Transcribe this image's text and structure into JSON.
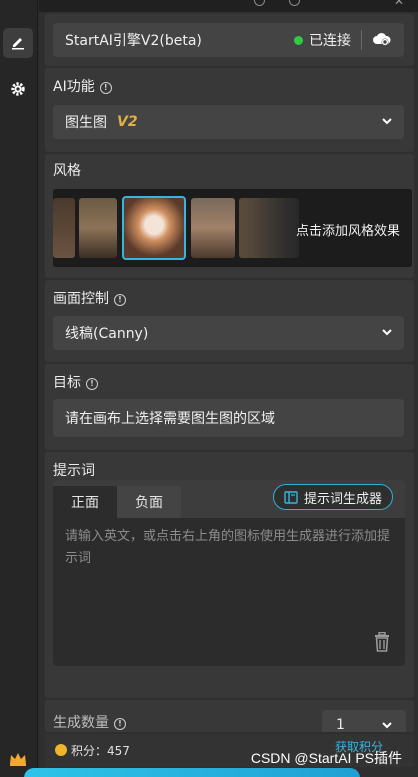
{
  "engine": {
    "title": "StartAI引擎V2(beta)",
    "status": "已连接"
  },
  "ai_function": {
    "label": "AI功能",
    "value": "图生图",
    "badge": "V2"
  },
  "style": {
    "label": "风格",
    "add_text": "点击添加风格效果"
  },
  "canvas_control": {
    "label": "画面控制",
    "value": "线稿(Canny)"
  },
  "target": {
    "label": "目标",
    "value": "请在画布上选择需要图生图的区域"
  },
  "prompt": {
    "label": "提示词",
    "tabs": [
      "正面",
      "负面"
    ],
    "generator_label": "提示词生成器",
    "placeholder": "请输入英文，或点击右上角的图标使用生成器进行添加提示词"
  },
  "gen_count": {
    "label": "生成数量",
    "value": "1"
  },
  "footer": {
    "points_label": "积分：457",
    "get_more": "获取积分"
  },
  "watermark": "CSDN @StartAI PS插件",
  "colors": {
    "accent": "#36b5e0",
    "status_green": "#2ecc40",
    "badge_gold": "#e0b040",
    "bg_panel": "#383838"
  },
  "icons": [
    "edit-icon",
    "gear-icon",
    "cloud-settings-icon",
    "chevron-down-icon",
    "info-icon",
    "book-icon",
    "trash-icon",
    "crown-icon",
    "coin-icon"
  ]
}
